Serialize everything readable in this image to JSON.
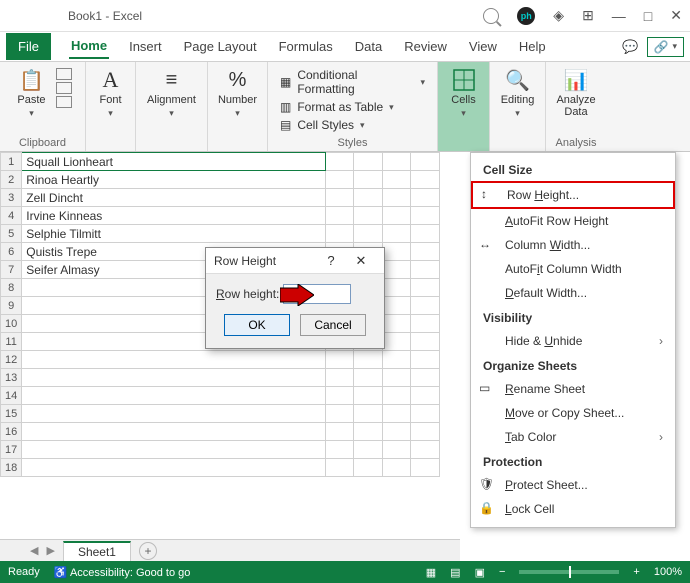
{
  "title": "Book1 - Excel",
  "tabs": {
    "file": "File",
    "home": "Home",
    "insert": "Insert",
    "pagelayout": "Page Layout",
    "formulas": "Formulas",
    "data": "Data",
    "review": "Review",
    "view": "View",
    "help": "Help"
  },
  "ribbon": {
    "clipboard": "Clipboard",
    "paste": "Paste",
    "font": "Font",
    "alignment": "Alignment",
    "number": "Number",
    "styles": "Styles",
    "condfmt": "Conditional Formatting",
    "fmttable": "Format as Table",
    "cellstyles": "Cell Styles",
    "cells": "Cells",
    "editing": "Editing",
    "analyze": "Analyze Data",
    "analysis": "Analysis"
  },
  "data_rows": [
    "Squall Lionheart",
    "Rinoa Heartly",
    "Zell Dincht",
    "Irvine Kinneas",
    "Selphie Tilmitt",
    "Quistis Trepe",
    "Seifer Almasy"
  ],
  "sheet_tab": "Sheet1",
  "status": {
    "ready": "Ready",
    "access": "Accessibility: Good to go",
    "zoom": "100%"
  },
  "menu": {
    "cellsize": "Cell Size",
    "rowheight": "Row Height...",
    "autofitrow": "AutoFit Row Height",
    "colwidth": "Column Width...",
    "autofitcol": "AutoFit Column Width",
    "defwidth": "Default Width...",
    "visibility": "Visibility",
    "hideunhide": "Hide & Unhide",
    "organize": "Organize Sheets",
    "rename": "Rename Sheet",
    "movecopy": "Move or Copy Sheet...",
    "tabcolor": "Tab Color",
    "protection": "Protection",
    "protectsheet": "Protect Sheet...",
    "lockcell": "Lock Cell"
  },
  "dialog": {
    "title": "Row Height",
    "label": "Row height:",
    "value": "45",
    "ok": "OK",
    "cancel": "Cancel",
    "help": "?",
    "close": "✕"
  }
}
